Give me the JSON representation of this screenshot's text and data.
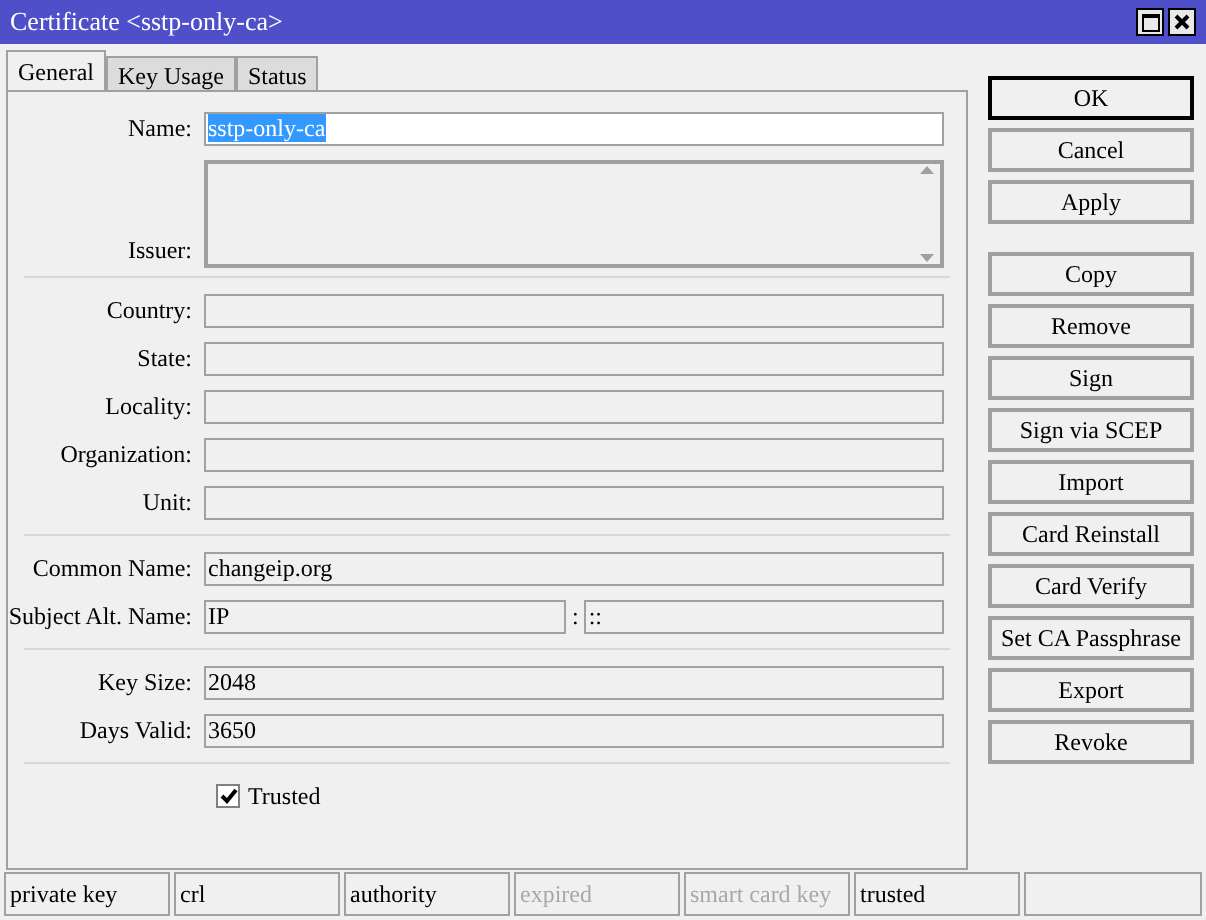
{
  "window": {
    "title": "Certificate <sstp-only-ca>"
  },
  "tabs": [
    {
      "label": "General",
      "selected": true
    },
    {
      "label": "Key Usage",
      "selected": false
    },
    {
      "label": "Status",
      "selected": false
    }
  ],
  "name": {
    "label": "Name:",
    "value": "sstp-only-ca"
  },
  "issuer": {
    "label": "Issuer:"
  },
  "subject_fields": [
    {
      "label": "Country:"
    },
    {
      "label": "State:"
    },
    {
      "label": "Locality:"
    },
    {
      "label": "Organization:"
    },
    {
      "label": "Unit:"
    }
  ],
  "common_name": {
    "label": "Common Name:",
    "value": "changeip.org"
  },
  "subject_alt_name": {
    "label": "Subject Alt. Name:",
    "type": "IP",
    "separator": ":",
    "value": "::"
  },
  "key_fields": [
    {
      "label": "Key Size:",
      "value": "2048"
    },
    {
      "label": "Days Valid:",
      "value": "3650"
    }
  ],
  "trusted": {
    "label": "Trusted",
    "checked": true
  },
  "buttons": [
    {
      "label": "OK",
      "default": true
    },
    {
      "label": "Cancel",
      "default": false
    },
    {
      "label": "Apply",
      "default": false
    },
    {
      "label": "Copy",
      "default": false
    },
    {
      "label": "Remove",
      "default": false
    },
    {
      "label": "Sign",
      "default": false
    },
    {
      "label": "Sign via SCEP",
      "default": false
    },
    {
      "label": "Import",
      "default": false
    },
    {
      "label": "Card Reinstall",
      "default": false
    },
    {
      "label": "Card Verify",
      "default": false
    },
    {
      "label": "Set CA Passphrase",
      "default": false
    },
    {
      "label": "Export",
      "default": false
    },
    {
      "label": "Revoke",
      "default": false
    }
  ],
  "status_bar": [
    {
      "text": "private key",
      "disabled": false
    },
    {
      "text": "crl",
      "disabled": false
    },
    {
      "text": "authority",
      "disabled": false
    },
    {
      "text": "expired",
      "disabled": true
    },
    {
      "text": "smart card key",
      "disabled": true
    },
    {
      "text": "trusted",
      "disabled": false
    }
  ]
}
